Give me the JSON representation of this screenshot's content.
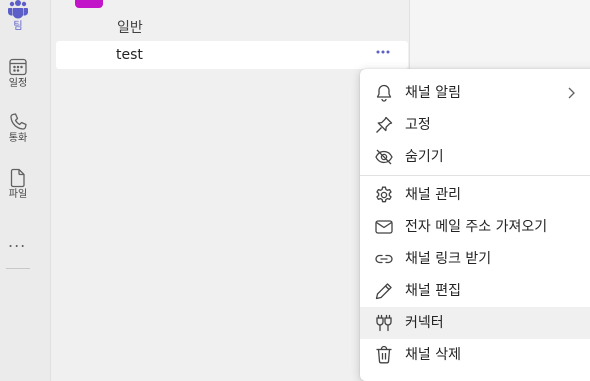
{
  "rail": {
    "items": [
      {
        "label": "팀",
        "icon": "teams-icon",
        "active": true
      },
      {
        "label": "일정",
        "icon": "calendar-icon",
        "active": false
      },
      {
        "label": "통화",
        "icon": "phone-icon",
        "active": false
      },
      {
        "label": "파일",
        "icon": "file-icon",
        "active": false
      }
    ],
    "more": "..."
  },
  "channels": {
    "general_label": "일반",
    "selected_label": "test",
    "more_options": "..."
  },
  "context_menu": {
    "items": [
      {
        "label": "채널 알림",
        "icon": "bell-icon",
        "has_submenu": true
      },
      {
        "label": "고정",
        "icon": "pin-icon"
      },
      {
        "label": "숨기기",
        "icon": "eye-off-icon"
      },
      {
        "label": "채널 관리",
        "icon": "gear-icon"
      },
      {
        "label": "전자 메일 주소 가져오기",
        "icon": "mail-icon"
      },
      {
        "label": "채널 링크 받기",
        "icon": "link-icon"
      },
      {
        "label": "채널 편집",
        "icon": "pencil-icon"
      },
      {
        "label": "커넥터",
        "icon": "connector-icon",
        "highlighted": true
      },
      {
        "label": "채널 삭제",
        "icon": "trash-icon"
      }
    ]
  },
  "colors": {
    "accent": "#5b5fc7",
    "team_avatar": "#c215c9",
    "menu_highlight": "#f0f0f0"
  }
}
